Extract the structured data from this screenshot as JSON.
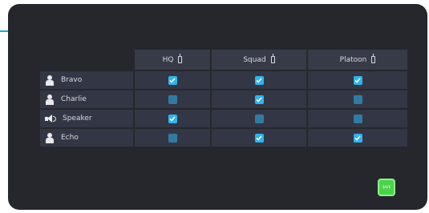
{
  "columns": [
    {
      "label": "HQ"
    },
    {
      "label": "Squad"
    },
    {
      "label": "Platoon"
    }
  ],
  "rows": [
    {
      "label": "Bravo",
      "icon": "person-icon",
      "checks": [
        true,
        true,
        true
      ]
    },
    {
      "label": "Charlie",
      "icon": "person-icon",
      "checks": [
        false,
        true,
        false
      ]
    },
    {
      "label": "Speaker",
      "icon": "speaker-icon",
      "checks": [
        true,
        false,
        false
      ]
    },
    {
      "label": "Echo",
      "icon": "person-icon",
      "checks": [
        false,
        true,
        true
      ]
    }
  ],
  "save_button": {
    "label": "SAVE"
  },
  "colors": {
    "accent": "#2fb4ee",
    "panel": "#26272c",
    "cell": "#333745",
    "save": "#4bd24b",
    "callout": "#1fa4dd"
  }
}
